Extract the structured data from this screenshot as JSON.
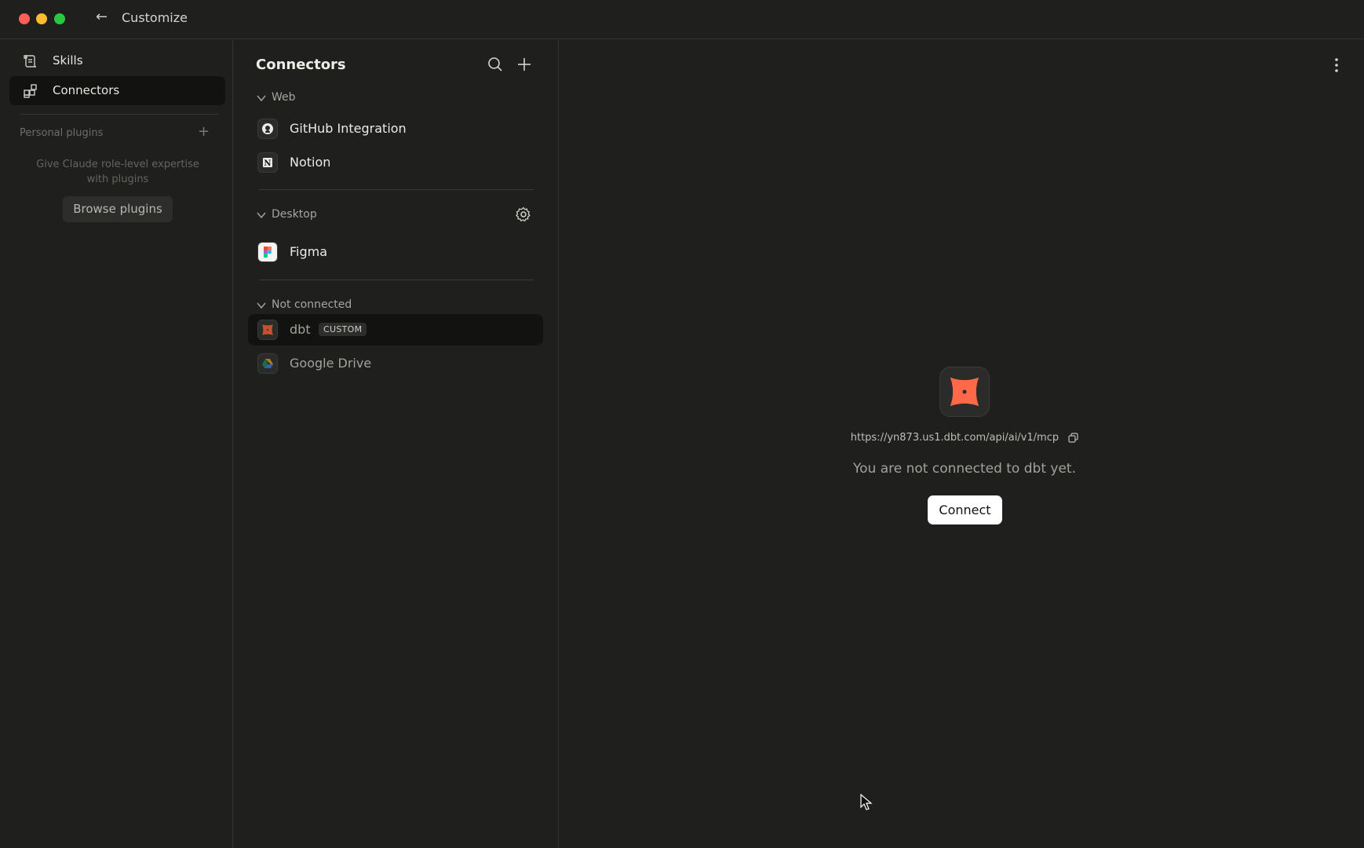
{
  "window": {
    "title": "Customize",
    "back_icon": "arrow-left-icon",
    "traffic_lights": {
      "close": "#ff5f57",
      "minimize": "#febc2e",
      "maximize": "#28c840"
    }
  },
  "sidebar": {
    "items": [
      {
        "label": "Skills",
        "icon": "skills-icon",
        "active": false
      },
      {
        "label": "Connectors",
        "icon": "connectors-icon",
        "active": true
      }
    ],
    "personal_plugins": {
      "label": "Personal plugins",
      "help_text": "Give Claude role-level expertise with plugins",
      "browse_label": "Browse plugins"
    }
  },
  "connectors_panel": {
    "title": "Connectors",
    "sections": {
      "web": {
        "label": "Web",
        "items": [
          {
            "label": "GitHub Integration",
            "icon": "github-icon"
          },
          {
            "label": "Notion",
            "icon": "notion-icon"
          }
        ]
      },
      "desktop": {
        "label": "Desktop",
        "items": [
          {
            "label": "Figma",
            "icon": "figma-icon"
          }
        ]
      },
      "not_connected": {
        "label": "Not connected",
        "items": [
          {
            "label": "dbt",
            "badge": "CUSTOM",
            "icon": "dbt-icon",
            "selected": true
          },
          {
            "label": "Google Drive",
            "icon": "google-drive-icon"
          }
        ]
      }
    }
  },
  "detail": {
    "url": "https://yn873.us1.dbt.com/api/ai/v1/mcp",
    "message": "You are not connected to dbt yet.",
    "connect_label": "Connect"
  },
  "colors": {
    "background": "#1f1f1e",
    "selected_row": "#121211",
    "dbt_orange": "#ff694a",
    "button_bg": "#ffffff"
  }
}
